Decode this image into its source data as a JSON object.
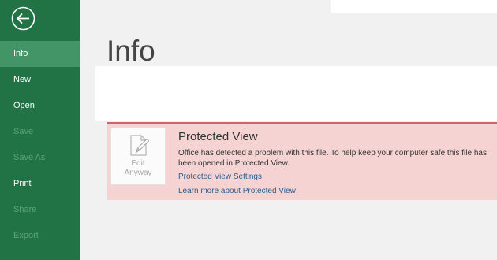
{
  "sidebar": {
    "back_icon": "back-arrow-icon",
    "accent_color": "#217346",
    "items": [
      {
        "label": "Info",
        "state": "selected"
      },
      {
        "label": "New",
        "state": "enabled"
      },
      {
        "label": "Open",
        "state": "enabled"
      },
      {
        "label": "Save",
        "state": "disabled"
      },
      {
        "label": "Save As",
        "state": "disabled"
      },
      {
        "label": "Print",
        "state": "enabled"
      },
      {
        "label": "Share",
        "state": "disabled"
      },
      {
        "label": "Export",
        "state": "disabled"
      }
    ]
  },
  "main": {
    "title": "Info"
  },
  "protected_view": {
    "title": "Protected View",
    "message": "Office has detected a problem with this file. To help keep your computer safe this file has been opened in Protected View.",
    "settings_link": "Protected View Settings",
    "learn_more_link": "Learn more about Protected View",
    "edit_button": {
      "line1": "Edit",
      "line2": "Anyway",
      "icon": "edit-document-icon"
    },
    "banner_color": "#f5d3d3",
    "accent_color": "#d3616b"
  }
}
